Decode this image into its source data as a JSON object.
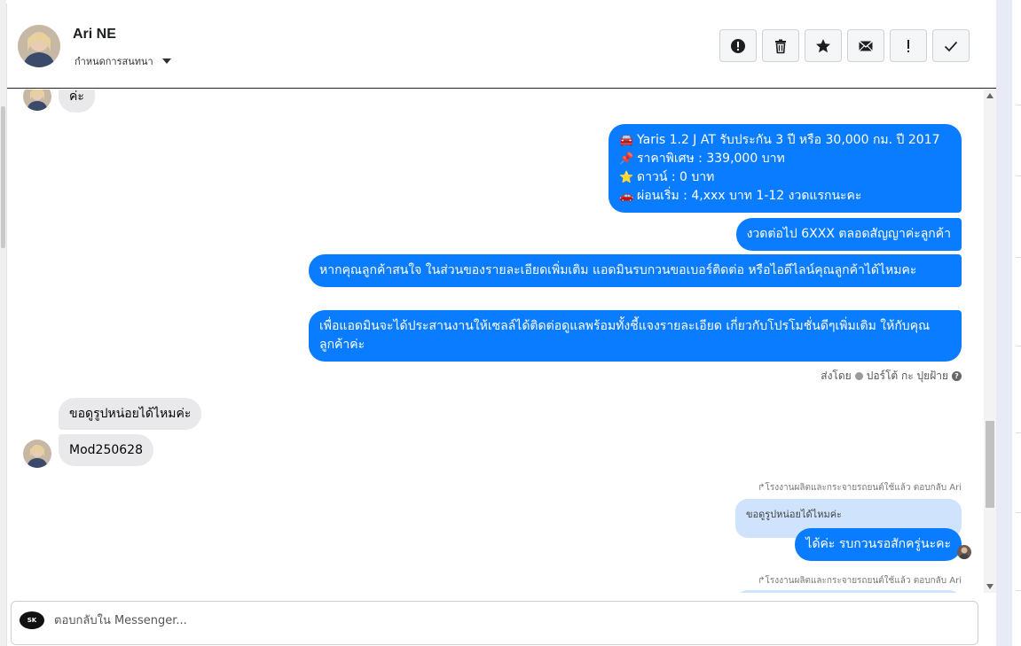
{
  "header": {
    "name": "Ari NE",
    "subtitle": "กำหนดการสนทนา"
  },
  "toolbar": {
    "icons": [
      "alert-circle-icon",
      "trash-icon",
      "star-icon",
      "envelope-icon",
      "exclamation-icon",
      "check-icon"
    ]
  },
  "messages": {
    "top_partial": "ค่ะ",
    "out1": {
      "line1": "Yaris 1.2 J AT รับประกัน 3 ปี หรือ 30,000 กม. ปี 2017",
      "line2": "ราคาพิเศษ : 339,000 บาท",
      "line3": "ดาวน์ : 0 บาท",
      "line4": "ผ่อนเริ่ม : 4,xxx บาท 1-12 งวดแรกนะคะ"
    },
    "out2": "งวดต่อไป 6XXX ตลอดสัญญาค่ะลูกค้า",
    "out3": "หากคุณลูกค้าสนใจ ในส่วนของรายละเอียดเพิ่มเติม แอดมินรบกวนขอเบอร์ติดต่อ หรือไอดีไลน์คุณลูกค้าได้ไหมคะ",
    "out4": "เพื่อแอดมินจะได้ประสานงานให้เซลล์ได้ติดต่อดูแลพร้อมทั้งชี้แจงรายละเอียด เกี่ยวกับโปรโมชั่นดีๆเพิ่มเติม ให้กับคุณลูกค้าค่ะ",
    "sent_by_label": "ส่งโดย",
    "sent_by_name": "ปอร์โต้ กะ ปุยฝ้าย",
    "in1": "ขอดูรูปหน่อยได้ไหมค่ะ",
    "in2": "Mod250628",
    "reply_meta1": "โรงงานผลิตและกระจายรถยนต์ใช้แล้ว ตอบกลับ Ari",
    "quoted1": "ขอดูรูปหน่อยได้ไหมค่ะ",
    "out5": "ได้ค่ะ รบกวนรอสักครู่นะคะ",
    "reply_meta2": "โรงงานผลิตและกระจายรถยนต์ใช้แล้ว ตอบกลับ Ari"
  },
  "composer": {
    "placeholder": "ตอบกลับใน Messenger...",
    "logo_text": "SK"
  },
  "colors": {
    "outgoing": "#0a7cff",
    "incoming": "#e9e9eb",
    "quoted": "#cfe3fd"
  }
}
